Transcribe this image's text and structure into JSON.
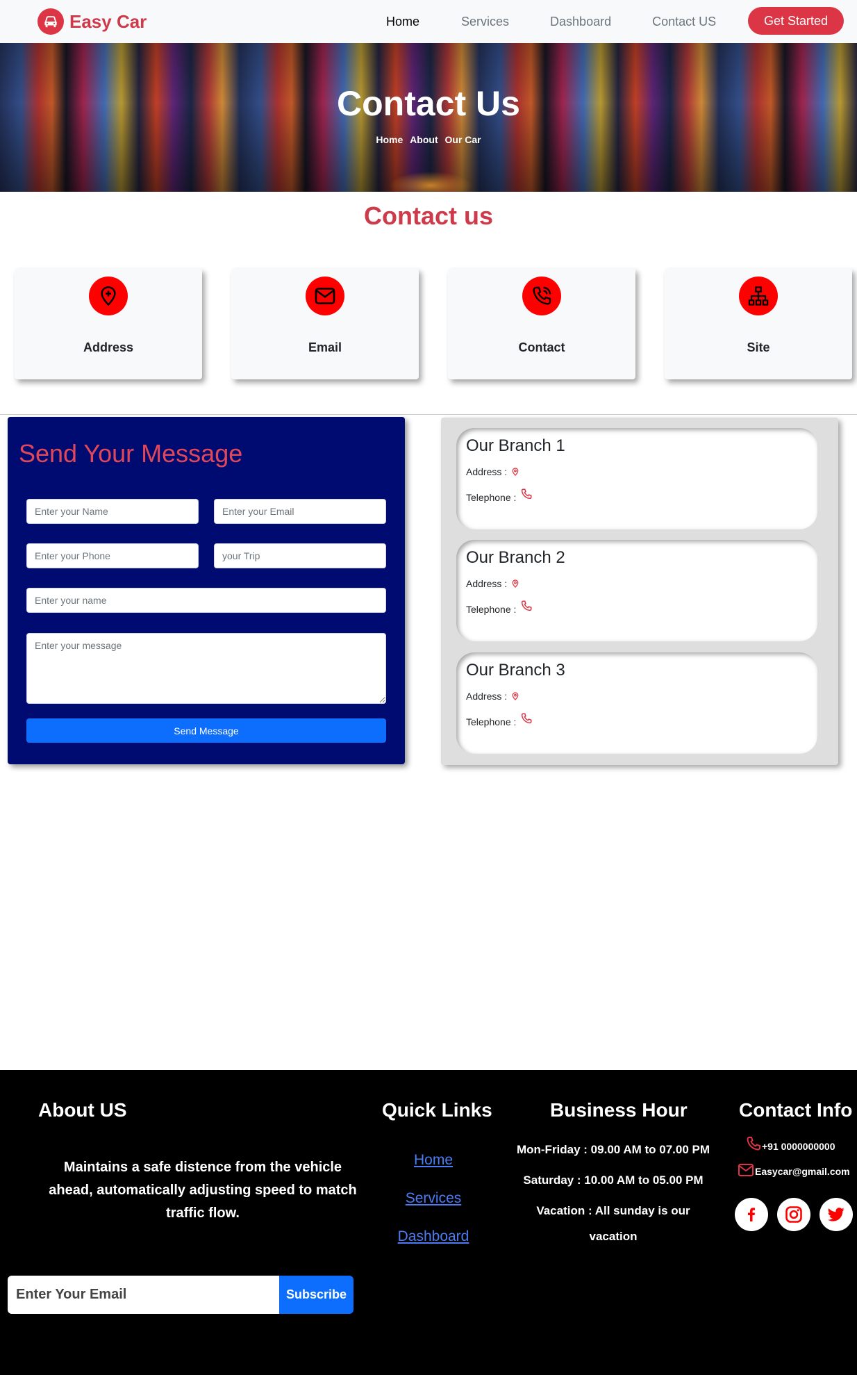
{
  "brand": {
    "name": "Easy Car"
  },
  "nav": {
    "items": [
      {
        "label": "Home",
        "active": true
      },
      {
        "label": "Services",
        "active": false
      },
      {
        "label": "Dashboard",
        "active": false
      },
      {
        "label": "Contact US",
        "active": false
      }
    ],
    "cta_label": "Get Started"
  },
  "hero": {
    "title": "Contact Us",
    "breadcrumb": [
      "Home",
      "About",
      "Our Car"
    ]
  },
  "contact": {
    "heading": "Contact us",
    "cards": [
      {
        "label": "Address",
        "icon": "location-pin-plus-icon"
      },
      {
        "label": "Email",
        "icon": "envelope-icon"
      },
      {
        "label": "Contact",
        "icon": "phone-call-icon"
      },
      {
        "label": "Site",
        "icon": "sitemap-icon"
      }
    ]
  },
  "form": {
    "title": "Send Your Message",
    "name_placeholder": "Enter your Name",
    "email_placeholder": "Enter your Email",
    "phone_placeholder": "Enter your Phone",
    "trip_placeholder": "your Trip",
    "name2_placeholder": "Enter your name",
    "message_placeholder": "Enter your message",
    "submit_label": "Send Message"
  },
  "branches": [
    {
      "title": "Our Branch 1",
      "address_label": "Address :",
      "telephone_label": "Telephone :"
    },
    {
      "title": "Our Branch 2",
      "address_label": "Address :",
      "telephone_label": "Telephone :"
    },
    {
      "title": "Our Branch 3",
      "address_label": "Address :",
      "telephone_label": "Telephone :"
    }
  ],
  "footer": {
    "about": {
      "heading": "About US",
      "text": "Maintains a safe distence from the vehicle ahead, automatically adjusting speed to match traffic flow."
    },
    "quick_links": {
      "heading": "Quick Links",
      "links": [
        "Home",
        "Services",
        "Dashboard"
      ]
    },
    "business_hour": {
      "heading": "Business Hour",
      "lines": [
        "Mon-Friday : 09.00 AM to 07.00 PM",
        "Saturday : 10.00 AM to 05.00 PM",
        "Vacation : All sunday is our vacation"
      ]
    },
    "contact_info": {
      "heading": "Contact Info",
      "phone": "+91 0000000000",
      "email": "Easycar@gmail.com",
      "social": [
        "facebook-icon",
        "instagram-icon",
        "twitter-icon"
      ]
    },
    "subscribe": {
      "placeholder": "Enter Your Email",
      "button_label": "Subscribe"
    }
  },
  "colors": {
    "accent_red": "#dc3545",
    "icon_red": "#ff0000",
    "form_bg": "#000b72",
    "primary_blue": "#0d6efd",
    "footer_bg": "#000000"
  }
}
